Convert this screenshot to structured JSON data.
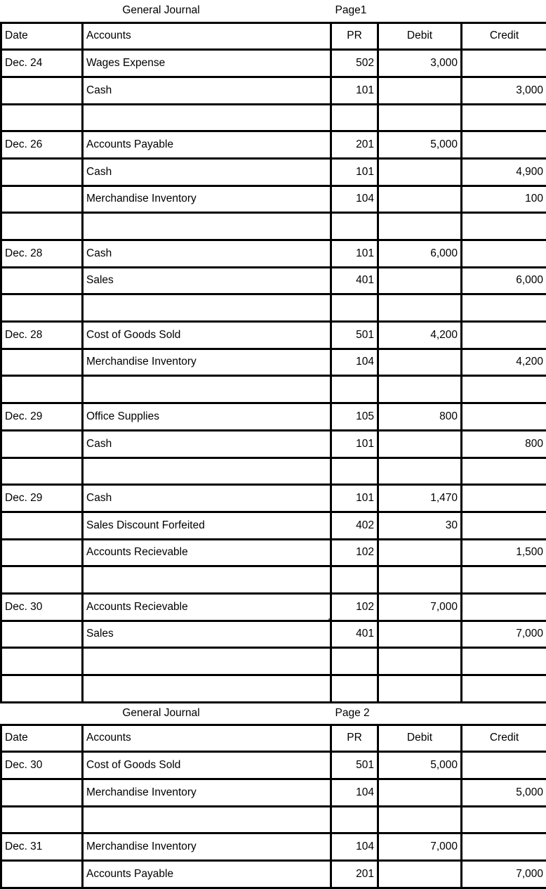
{
  "document": {
    "title": "General Journal",
    "selection": {
      "color": "#3A7050",
      "cell_text": "Accounts Recievable"
    }
  },
  "pages": [
    {
      "title": "General Journal",
      "page_label": "Page1",
      "columns": [
        "Date",
        "Accounts",
        "PR",
        "Debit",
        "Credit"
      ],
      "rows": [
        {
          "date": "Dec. 24",
          "account": "Wages Expense",
          "indent": false,
          "pr": "502",
          "debit": "3,000",
          "credit": ""
        },
        {
          "date": "",
          "account": "Cash",
          "indent": true,
          "pr": "101",
          "debit": "",
          "credit": "3,000"
        },
        {
          "date": "",
          "account": "",
          "indent": false,
          "pr": "",
          "debit": "",
          "credit": ""
        },
        {
          "date": "Dec. 26",
          "account": "Accounts Payable",
          "indent": false,
          "pr": "201",
          "debit": "5,000",
          "credit": ""
        },
        {
          "date": "",
          "account": "Cash",
          "indent": true,
          "pr": "101",
          "debit": "",
          "credit": "4,900"
        },
        {
          "date": "",
          "account": "Merchandise Inventory",
          "indent": true,
          "pr": "104",
          "debit": "",
          "credit": "100"
        },
        {
          "date": "",
          "account": "",
          "indent": false,
          "pr": "",
          "debit": "",
          "credit": ""
        },
        {
          "date": "Dec. 28",
          "account": "Cash",
          "indent": false,
          "pr": "101",
          "debit": "6,000",
          "credit": ""
        },
        {
          "date": "",
          "account": "Sales",
          "indent": true,
          "pr": "401",
          "debit": "",
          "credit": "6,000"
        },
        {
          "date": "",
          "account": "",
          "indent": false,
          "pr": "",
          "debit": "",
          "credit": ""
        },
        {
          "date": "Dec. 28",
          "account": "Cost of Goods Sold",
          "indent": false,
          "pr": "501",
          "debit": "4,200",
          "credit": ""
        },
        {
          "date": "",
          "account": "Merchandise Inventory",
          "indent": true,
          "pr": "104",
          "debit": "",
          "credit": "4,200"
        },
        {
          "date": "",
          "account": "",
          "indent": false,
          "pr": "",
          "debit": "",
          "credit": ""
        },
        {
          "date": "Dec. 29",
          "account": "Office Supplies",
          "indent": false,
          "pr": "105",
          "debit": "800",
          "credit": ""
        },
        {
          "date": "",
          "account": "Cash",
          "indent": true,
          "pr": "101",
          "debit": "",
          "credit": "800"
        },
        {
          "date": "",
          "account": "",
          "indent": false,
          "pr": "",
          "debit": "",
          "credit": ""
        },
        {
          "date": "Dec. 29",
          "account": "Cash",
          "indent": false,
          "pr": "101",
          "debit": "1,470",
          "credit": ""
        },
        {
          "date": "",
          "account": "Sales Discount Forfeited",
          "indent": false,
          "pr": "402",
          "debit": "30",
          "credit": ""
        },
        {
          "date": "",
          "account": "Accounts Recievable",
          "indent": true,
          "pr": "102",
          "debit": "",
          "credit": "1,500"
        },
        {
          "date": "",
          "account": "",
          "indent": false,
          "pr": "",
          "debit": "",
          "credit": ""
        },
        {
          "date": "Dec. 30",
          "account": "Accounts Recievable",
          "indent": false,
          "pr": "102",
          "debit": "7,000",
          "credit": "",
          "selected": true
        },
        {
          "date": "",
          "account": "Sales",
          "indent": true,
          "pr": "401",
          "debit": "",
          "credit": "7,000"
        },
        {
          "date": "",
          "account": "",
          "indent": false,
          "pr": "",
          "debit": "",
          "credit": ""
        },
        {
          "date": "",
          "account": "",
          "indent": false,
          "pr": "",
          "debit": "",
          "credit": ""
        }
      ]
    },
    {
      "title": "General Journal",
      "page_label": "Page 2",
      "columns": [
        "Date",
        "Accounts",
        "PR",
        "Debit",
        "Credit"
      ],
      "rows": [
        {
          "date": "Dec. 30",
          "account": "Cost of Goods Sold",
          "indent": false,
          "pr": "501",
          "debit": "5,000",
          "credit": ""
        },
        {
          "date": "",
          "account": "Merchandise Inventory",
          "indent": true,
          "pr": "104",
          "debit": "",
          "credit": "5,000"
        },
        {
          "date": "",
          "account": "",
          "indent": false,
          "pr": "",
          "debit": "",
          "credit": ""
        },
        {
          "date": "Dec. 31",
          "account": "Merchandise Inventory",
          "indent": false,
          "pr": "104",
          "debit": "7,000",
          "credit": ""
        },
        {
          "date": "",
          "account": "Accounts Payable",
          "indent": true,
          "pr": "201",
          "debit": "",
          "credit": "7,000"
        }
      ]
    }
  ]
}
